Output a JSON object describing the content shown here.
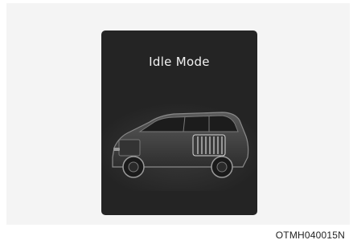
{
  "display": {
    "title": "Idle Mode"
  },
  "illustration": {
    "subject": "hybrid-vehicle-icon",
    "battery_color": "#d6d6d6",
    "body_color": "#8a8a8a"
  },
  "caption": {
    "code": "OTMH040015N"
  }
}
